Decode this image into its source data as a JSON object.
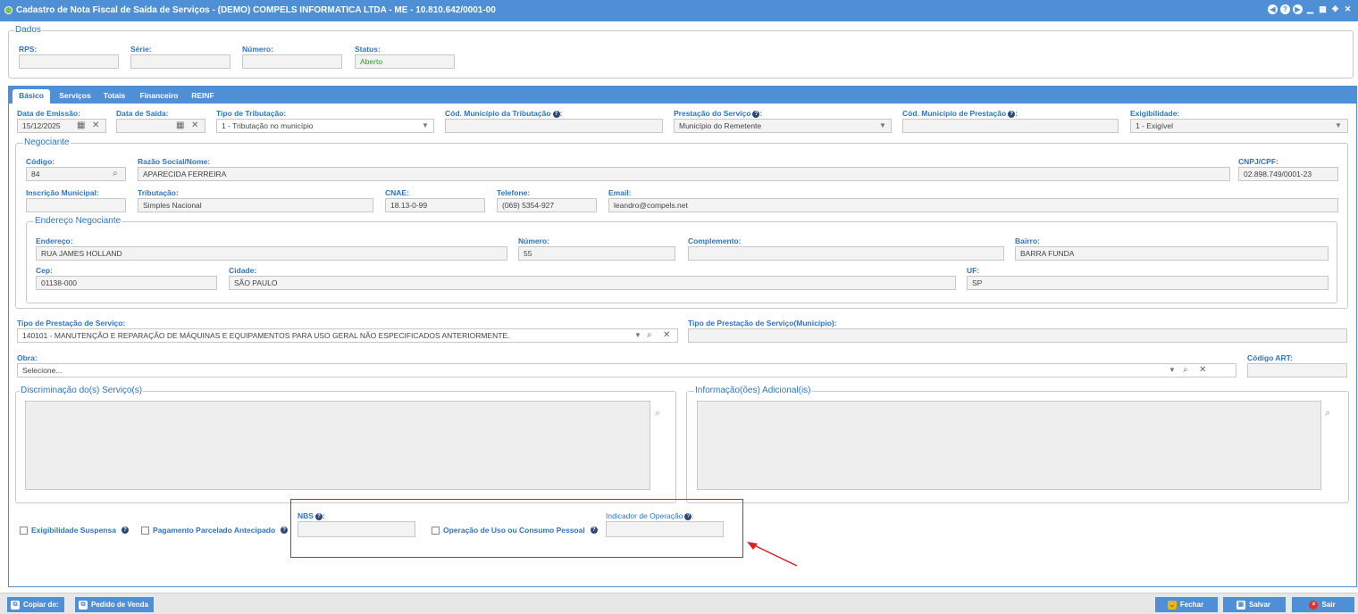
{
  "window": {
    "title": "Cadastro de Nota Fiscal de Saída de Serviços - (DEMO) COMPELS INFORMATICA LTDA - ME - 10.810.642/0001-00"
  },
  "dados": {
    "legend": "Dados",
    "rps_label": "RPS:",
    "rps_value": "",
    "serie_label": "Série:",
    "serie_value": "",
    "numero_label": "Número:",
    "numero_value": "",
    "status_label": "Status:",
    "status_value": "Aberto"
  },
  "tabs": [
    "Básico",
    "Serviços",
    "Totais",
    "Financeiro",
    "REINF"
  ],
  "basico": {
    "data_emissao_label": "Data de Emissão:",
    "data_emissao_value": "15/12/2025",
    "data_saida_label": "Data de Saída:",
    "data_saida_value": "",
    "tipo_tributacao_label": "Tipo de Tributação:",
    "tipo_tributacao_value": "1 - Tributação no município",
    "cod_municipio_tributacao_label": "Cód. Município da Tributação",
    "cod_municipio_tributacao_value": "",
    "prestacao_servico_label": "Prestação do Serviço",
    "prestacao_servico_value": "Município do Remetente",
    "cod_municipio_prestacao_label": "Cód. Município de Prestação",
    "cod_municipio_prestacao_value": "",
    "exigibilidade_label": "Exigibilidade:",
    "exigibilidade_value": "1 - Exigível"
  },
  "negociante": {
    "legend": "Negociante",
    "codigo_label": "Código:",
    "codigo_value": "84",
    "razao_label": "Razão Social/Nome:",
    "razao_value": "APARECIDA FERREIRA",
    "cnpj_label": "CNPJ/CPF:",
    "cnpj_value": "02.898.749/0001-23",
    "inscricao_label": "Inscrição Municipal:",
    "inscricao_value": "",
    "tributacao_label": "Tributação:",
    "tributacao_value": "Simples Nacional",
    "cnae_label": "CNAE:",
    "cnae_value": "18.13-0-99",
    "telefone_label": "Telefone:",
    "telefone_value": "(069) 5354-927",
    "email_label": "Email:",
    "email_value": "leandro@compels.net"
  },
  "endereco": {
    "legend": "Endereço Negociante",
    "endereco_label": "Endereço:",
    "endereco_value": "RUA JAMES HOLLAND",
    "numero_label": "Número:",
    "numero_value": "55",
    "complemento_label": "Complemento:",
    "complemento_value": "",
    "bairro_label": "Bairro:",
    "bairro_value": "BARRA FUNDA",
    "cep_label": "Cep:",
    "cep_value": "01138-000",
    "cidade_label": "Cidade:",
    "cidade_value": "SÃO PAULO",
    "uf_label": "UF:",
    "uf_value": "SP"
  },
  "servico": {
    "tipo_prestacao_label": "Tipo de Prestação de Serviço:",
    "tipo_prestacao_value": "140101 - MANUTENÇÃO E REPARAÇÃO DE MÁQUINAS E EQUIPAMENTOS PARA USO GERAL NÃO ESPECIFICADOS ANTERIORMENTE.",
    "tipo_prestacao_municipio_label": "Tipo de Prestação de Serviço(Município):",
    "tipo_prestacao_municipio_value": "",
    "obra_label": "Obra:",
    "obra_value": "Selecione...",
    "codigo_art_label": "Código ART:",
    "codigo_art_value": "",
    "discriminacao_legend": "Discriminação do(s) Serviço(s)",
    "informacoes_legend": "Informação(ões) Adicional(is)"
  },
  "flags": {
    "exigibilidade_suspensa": "Exigibilidade Suspensa",
    "pagamento_parcelado": "Pagamento Parcelado Antecipado",
    "nbs_label": "NBS",
    "nbs_value": "",
    "operacao_uso": "Operação de Uso ou Consumo Pessoal",
    "indicador_operacao_label": "Indicador de Operação",
    "indicador_operacao_value": ""
  },
  "footer": {
    "copiar": "Copiar de:",
    "pedido": "Pedido de Venda",
    "fechar": "Fechar",
    "salvar": "Salvar",
    "sair": "Sair"
  },
  "colors": {
    "accent": "#4f8fd6",
    "label": "#2b74c7",
    "highlight": "#e02020"
  }
}
